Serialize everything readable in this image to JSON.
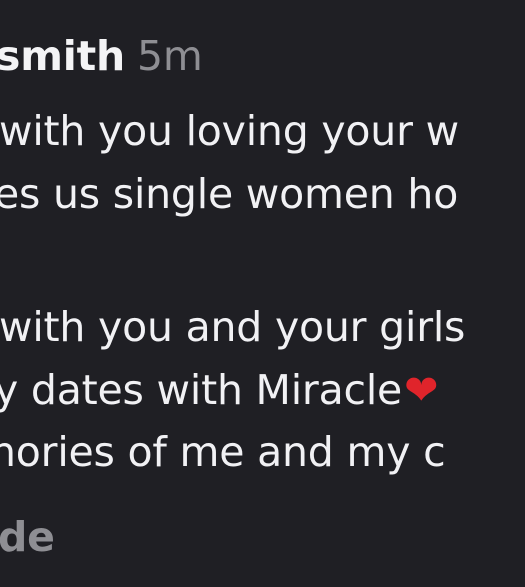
{
  "comment": {
    "username": "smith",
    "time": "5m",
    "lines": [
      "with you loving your w",
      "es us single women ho",
      "with you and your girls",
      "y dates with Miracle",
      "nories of me and my c"
    ],
    "emoji": "❤",
    "footer_text": "de"
  },
  "colors": {
    "background": "#1f1f24",
    "primary_text": "#f3f3f5",
    "secondary_text": "#8e8e93",
    "heart": "#e0242b"
  }
}
